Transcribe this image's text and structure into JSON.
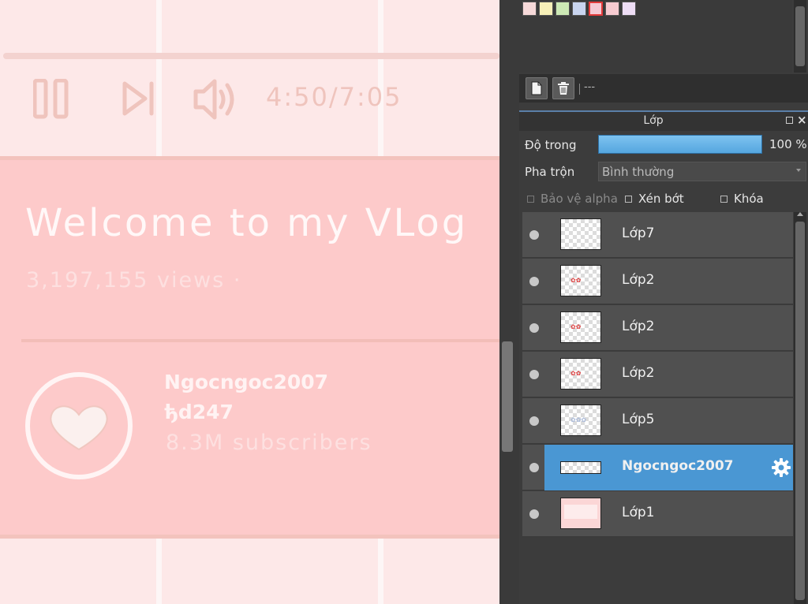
{
  "canvas": {
    "time": "4:50/7:05",
    "title": "Welcome to my VLog",
    "views": "3,197,155 views ·",
    "channel_name": "Ngocngoc2007",
    "channel_handle": "ђd247",
    "subscribers": "8.3M subscribers"
  },
  "palette": {
    "swatches": [
      "#f6d9d9",
      "#f7f0b8",
      "#cde9b5",
      "#c9d4ef",
      "#f4c9d4",
      "#f7cbd1",
      "#eeddf5"
    ],
    "selected_index": 4,
    "selected_border": "#e23a3a"
  },
  "toolbar": {
    "status": "---"
  },
  "layer_panel": {
    "title": "Lớp",
    "opacity_label": "Độ trong",
    "opacity_value": "100 %",
    "blend_label": "Pha trộn",
    "blend_value": "Bình thường",
    "protect_alpha": "Bảo vệ alpha",
    "clip": "Xén bớt",
    "lock": "Khóa",
    "layers": [
      {
        "name": "Lớp7",
        "active": false
      },
      {
        "name": "Lớp2",
        "active": false
      },
      {
        "name": "Lớp2",
        "active": false
      },
      {
        "name": "Lớp2",
        "active": false
      },
      {
        "name": "Lớp5",
        "active": false
      },
      {
        "name": "Ngocngoc2007",
        "active": true
      },
      {
        "name": "Lớp1",
        "active": false
      }
    ]
  },
  "colors": {
    "accent": "#4a97d3",
    "opacity_bar": "#6bb6ea",
    "canvas_pink": "#fdcaca"
  }
}
